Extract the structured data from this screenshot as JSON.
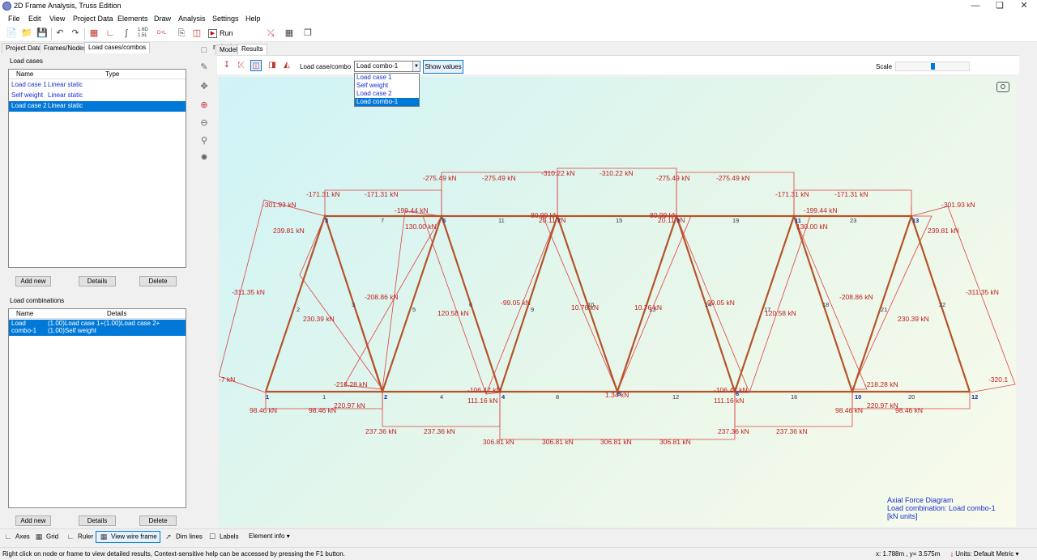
{
  "window": {
    "title": "2D Frame Analysis, Truss Edition"
  },
  "menu": [
    "File",
    "Edit",
    "View",
    "Project Data",
    "Elements",
    "Draw",
    "Analysis",
    "Settings",
    "Help"
  ],
  "toolbar": {
    "ratio_top": "1.6D",
    "ratio_bottom": "1.5L",
    "dl_label": "D+L",
    "run_label": "Run Analysis"
  },
  "left_tabs": [
    "Project Data",
    "Frames/Nodes",
    "Load cases/combos"
  ],
  "load_cases": {
    "group_label": "Load cases",
    "col_name": "Name",
    "col_type": "Type",
    "rows": [
      {
        "name": "Load case 1",
        "type": "Linear static"
      },
      {
        "name": "Self weight",
        "type": "Linear static"
      },
      {
        "name": "Load case 2",
        "type": "Linear static"
      }
    ],
    "btn_add": "Add new",
    "btn_details": "Details",
    "btn_delete": "Delete"
  },
  "load_combinations": {
    "group_label": "Load combinations",
    "col_name": "Name",
    "col_details": "Details",
    "rows": [
      {
        "name": "Load combo-1",
        "details": "(1.00)Load case 1+(1.00)Load case 2+(1.00)Self weight"
      }
    ],
    "btn_add": "Add new",
    "btn_details": "Details",
    "btn_delete": "Delete"
  },
  "view_tabs": [
    "Model",
    "Results"
  ],
  "results_bar": {
    "combo_label": "Load case/combo",
    "combo_value": "Load combo-1",
    "show_values": "Show values",
    "scale_label": "Scale",
    "scale_level": 0.5
  },
  "dropdown_options": [
    "Load case 1",
    "Self weight",
    "Load case 2",
    "Load combo-1"
  ],
  "diagram_info": {
    "line1": "Axial Force Diagram",
    "line2": "Load combination: Load combo-1",
    "line3": "[kN units]"
  },
  "bottom_toolbar": {
    "axes": "Axes",
    "grid": "Grid",
    "ruler": "Ruler",
    "wireframe": "View wire frame",
    "dimlines": "Dim lines",
    "labels": "Labels",
    "element_info": "Element info"
  },
  "status": {
    "hint": "Right click on node or frame to view detailed results, Context-sensitive help can be accessed by pressing the F1 button.",
    "coords": "x: 1.788m , y= 3.575m",
    "units": "Units: Default Metric"
  },
  "truss": {
    "node_labels": [
      "1",
      "2",
      "3",
      "4",
      "5",
      "6",
      "7",
      "8",
      "9",
      "10",
      "11",
      "12",
      "13"
    ],
    "member_labels": [
      "1",
      "2",
      "3",
      "4",
      "5",
      "6",
      "7",
      "8",
      "9",
      "10",
      "11",
      "12",
      "13",
      "14",
      "15",
      "16",
      "17",
      "18",
      "19",
      "20",
      "21",
      "22",
      "23"
    ],
    "force_labels": [
      "-275.49 kN",
      "-275.49 kN",
      "-310.22 kN",
      "-310.22 kN",
      "-275.49 kN",
      "-275.49 kN",
      "-171.31 kN",
      "-171.31 kN",
      "-171.31 kN",
      "-171.31 kN",
      "-301.93 kN",
      "-301.93 kN",
      "239.81 kN",
      "239.81 kN",
      "-199.44 kN",
      "-199.44 kN",
      "130.00 kN",
      "130.00 kN",
      "80.99 kN",
      "20.11 kN",
      "80.99 kN",
      "20.11 kN",
      "-311.35 kN",
      "-311.35 kN",
      "-208.86 kN",
      "-208.86 kN",
      "230.39 kN",
      "230.39 kN",
      "120.58 kN",
      "120.58 kN",
      "-99.05 kN",
      "-99.05 kN",
      "10.76 kN",
      "10.76 kN",
      "-7 kN",
      "-320.1",
      "-218.28 kN",
      "-218.28 kN",
      "-106.47 kN",
      "-106.47 kN",
      "220.97 kN",
      "220.97 kN",
      "111.16 kN",
      "111.16 kN",
      "1.34 kN",
      "98.46 kN",
      "98.46 kN",
      "98.46 kN",
      "98.46 kN",
      "237.36 kN",
      "237.36 kN",
      "237.36 kN",
      "237.36 kN",
      "306.81 kN",
      "306.81 kN",
      "306.81 kN",
      "306.81 kN"
    ]
  }
}
